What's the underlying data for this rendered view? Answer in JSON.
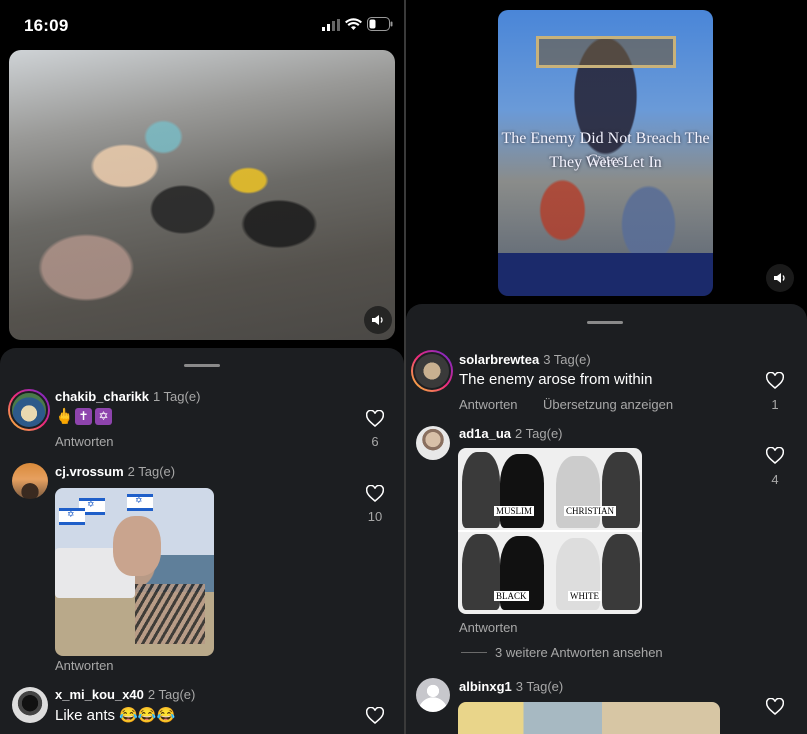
{
  "left_screen": {
    "status_bar": {
      "time": "16:09"
    },
    "comments": [
      {
        "username": "chakib_charikk",
        "time": "1 Tag(e)",
        "text_emoji": [
          "🖕",
          "✝",
          "✡"
        ],
        "reply_label": "Antworten",
        "likes": "6"
      },
      {
        "username": "cj.vrossum",
        "time": "2 Tag(e)",
        "reply_label": "Antworten",
        "likes": "10"
      },
      {
        "username": "x_mi_kou_x40",
        "time": "2 Tag(e)",
        "text": "Like ants 😂😂😂"
      }
    ]
  },
  "right_screen": {
    "video_caption_line1": "The Enemy Did Not Breach The Gates",
    "video_caption_line2": "They Were Let In",
    "comments": [
      {
        "username": "solarbrewtea",
        "time": "3 Tag(e)",
        "text": "The enemy arose from within",
        "reply_label": "Antworten",
        "translate_label": "Übersetzung anzeigen",
        "likes": "1"
      },
      {
        "username": "ad1a_ua",
        "time": "2 Tag(e)",
        "image_labels": [
          "MUSLIM",
          "CHRISTIAN",
          "BLACK",
          "WHITE"
        ],
        "reply_label": "Antworten",
        "more_replies": "3 weitere Antworten ansehen",
        "likes": "4"
      },
      {
        "username": "albinxg1",
        "time": "3 Tag(e)"
      }
    ]
  },
  "colors": {
    "background": "#000000",
    "sheet": "#1c1e21",
    "secondary_text": "#a8a8a8",
    "story_ring_start": "#f9ce34",
    "story_ring_mid": "#ee2a7b",
    "story_ring_end": "#6228d7"
  },
  "icons": [
    "signal-icon",
    "wifi-icon",
    "battery-icon",
    "speaker-icon",
    "heart-icon"
  ]
}
